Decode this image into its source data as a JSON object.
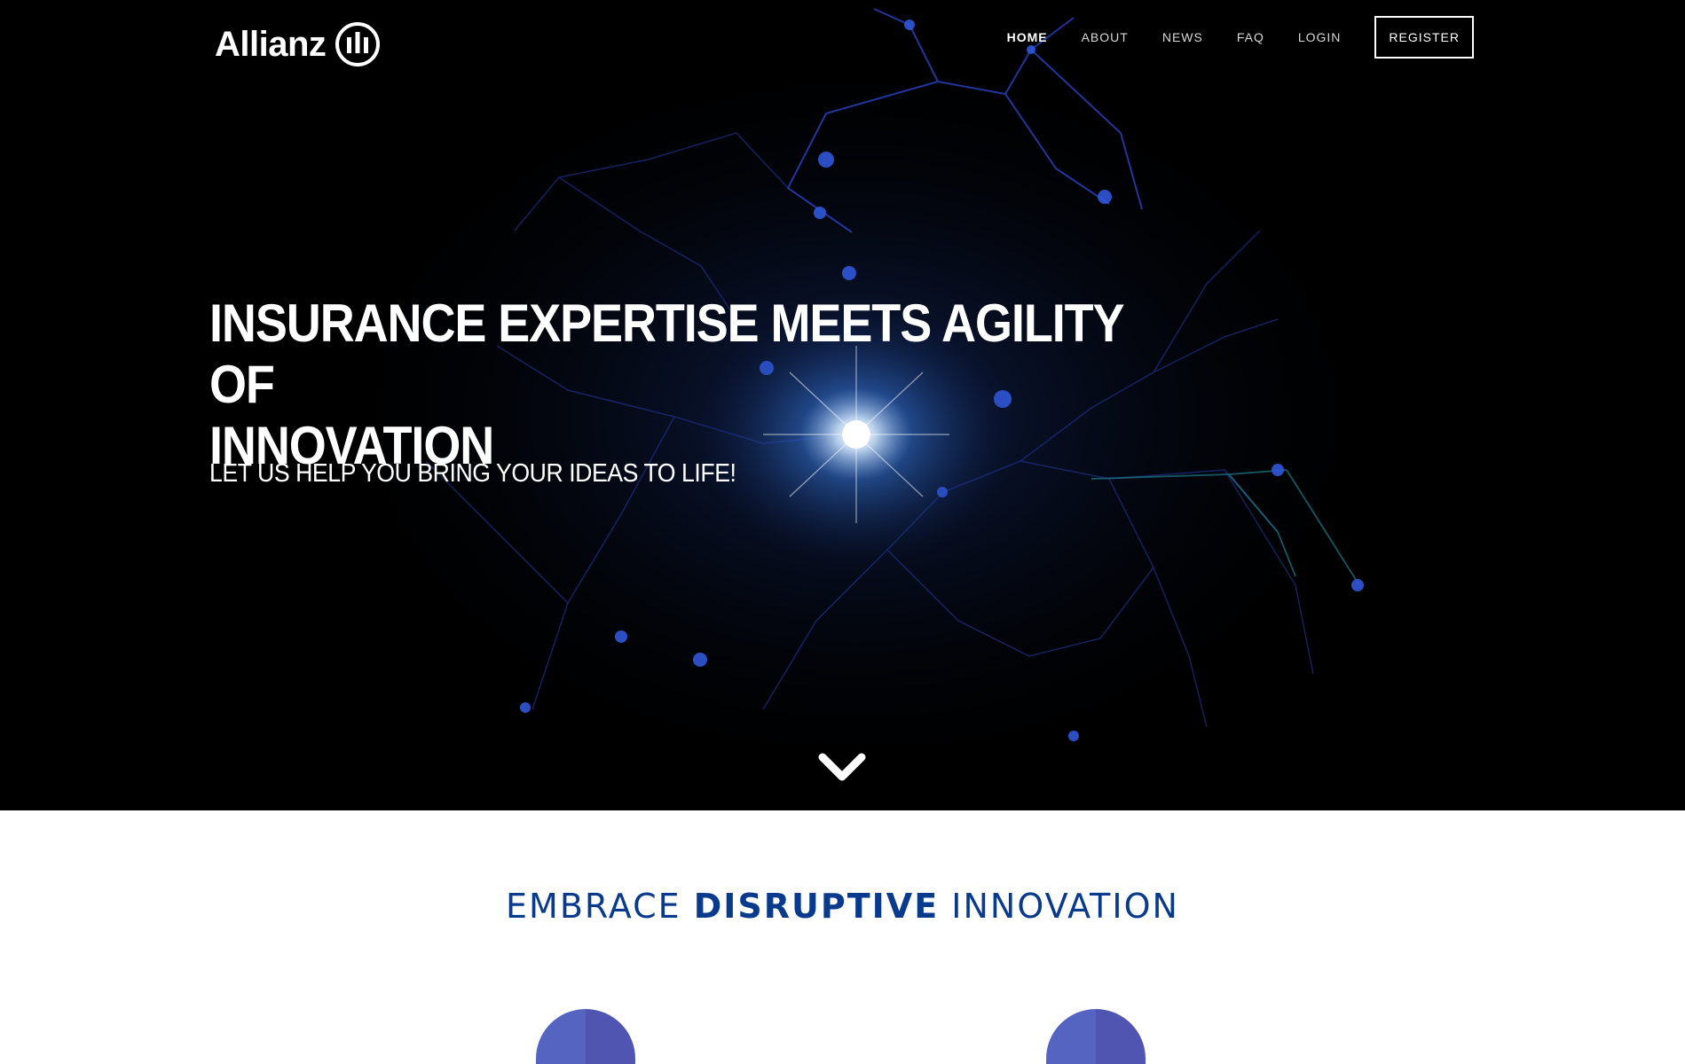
{
  "brand": {
    "name": "Allianz",
    "logo_icon": "allianz-emblem-icon"
  },
  "nav": {
    "items": [
      {
        "label": "HOME",
        "active": true
      },
      {
        "label": "ABOUT",
        "active": false
      },
      {
        "label": "NEWS",
        "active": false
      },
      {
        "label": "FAQ",
        "active": false
      },
      {
        "label": "LOGIN",
        "active": false
      }
    ],
    "register_label": "REGISTER"
  },
  "hero": {
    "title_line1": "INSURANCE EXPERTISE MEETS AGILITY OF",
    "title_line2": "INNOVATION",
    "subtitle": "LET US HELP YOU BRING YOUR IDEAS TO LIFE!",
    "scroll_icon": "chevron-down-icon"
  },
  "section": {
    "title_part1": "EMBRACE ",
    "title_bold": "DISRUPTIVE",
    "title_part2": " INNOVATION"
  },
  "colors": {
    "hero_background": "#000000",
    "accent_blue": "#0a3a8c",
    "feature_icon_blue": "#5563c1"
  }
}
